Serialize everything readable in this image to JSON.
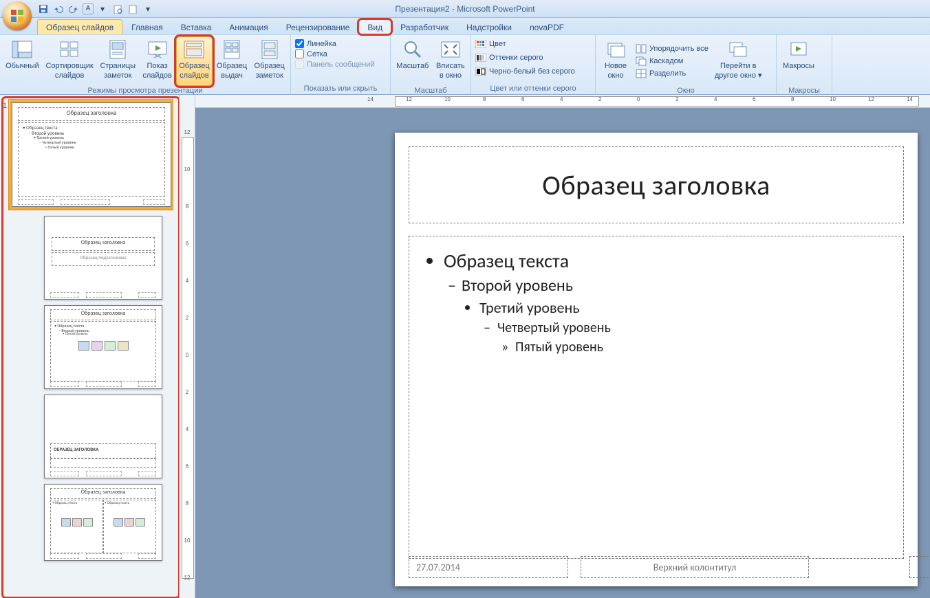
{
  "app": {
    "title": "Презентация2 - Microsoft PowerPoint"
  },
  "qat": {
    "save": "save-icon",
    "undo": "undo-icon",
    "redo": "redo-icon"
  },
  "tabs": {
    "master": "Образец слайдов",
    "home": "Главная",
    "insert": "Вставка",
    "animation": "Анимация",
    "review": "Рецензирование",
    "view": "Вид",
    "developer": "Разработчик",
    "addins": "Надстройки",
    "novapdf": "novaPDF"
  },
  "ribbon": {
    "group_views": "Режимы просмотра презентации",
    "normal": "Обычный",
    "sorter_l1": "Сортировщик",
    "sorter_l2": "слайдов",
    "notes_l1": "Страницы",
    "notes_l2": "заметок",
    "show_l1": "Показ",
    "show_l2": "слайдов",
    "slide_master_l1": "Образец",
    "slide_master_l2": "слайдов",
    "handout_master_l1": "Образец",
    "handout_master_l2": "выдач",
    "notes_master_l1": "Образец",
    "notes_master_l2": "заметок",
    "group_show_hide": "Показать или скрыть",
    "ruler": "Линейка",
    "grid": "Сетка",
    "message_bar": "Панель сообщений",
    "group_zoom": "Масштаб",
    "zoom": "Масштаб",
    "fit_l1": "Вписать",
    "fit_l2": "в окно",
    "group_color": "Цвет или оттенки серого",
    "color": "Цвет",
    "grayscale": "Оттенки серого",
    "bw": "Черно-белый без серого",
    "group_window": "Окно",
    "new_window_l1": "Новое",
    "new_window_l2": "окно",
    "arrange": "Упорядочить все",
    "cascade": "Каскадом",
    "split": "Разделить",
    "switch_l1": "Перейти в",
    "switch_l2": "другое окно",
    "group_macros": "Макросы",
    "macros": "Макросы"
  },
  "slide": {
    "title": "Образец заголовка",
    "lvl1": "Образец текста",
    "lvl2": "Второй уровень",
    "lvl3": "Третий уровень",
    "lvl4": "Четвертый уровень",
    "lvl5": "Пятый уровень",
    "date": "27.07.2014",
    "footer": "Верхний колонтитул"
  },
  "thumbs": {
    "num1": "1",
    "master_title": "Образец заголовка",
    "master_l1": "Образец текста",
    "master_l2": "– Второй уровень",
    "master_l3": "• Третий уровень",
    "master_l4": "– Четвертый уровень",
    "master_l5": "» Пятый уровень",
    "layout1_title": "Образец заголовка",
    "layout1_sub": "Образец подзаголовка",
    "layout2_title": "Образец заголовка",
    "layout2_l1": "Образец текста",
    "layout2_l2": "– Второй уровень",
    "layout2_l3": "• Третий уровень",
    "layout3_title": "ОБРАЗЕЦ ЗАГОЛОВКА",
    "layout4_title": "Образец заголовка",
    "layout4_colA": "Образец текста",
    "layout4_colB": "Образец текста"
  },
  "ruler_ticks": [
    "14",
    "12",
    "10",
    "8",
    "6",
    "4",
    "2",
    "0",
    "2",
    "4",
    "6",
    "8",
    "10",
    "12",
    "14"
  ],
  "vruler_ticks": [
    "12",
    "10",
    "8",
    "6",
    "4",
    "2",
    "0",
    "2",
    "4",
    "6",
    "8",
    "10",
    "12"
  ]
}
